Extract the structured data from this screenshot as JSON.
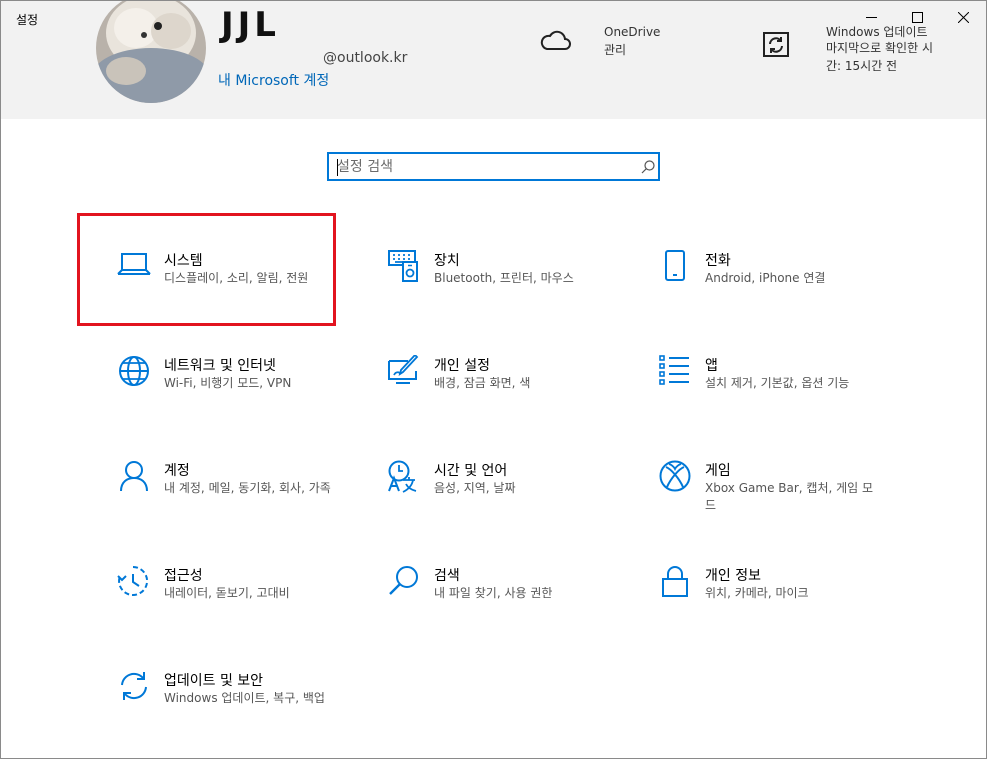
{
  "window": {
    "title": "설정"
  },
  "account": {
    "name": "JJL",
    "email": "@outlook.kr",
    "link": "내 Microsoft 계정"
  },
  "onedrive": {
    "title": "OneDrive",
    "subtitle": "관리"
  },
  "update": {
    "title": "Windows 업데이트",
    "line1": "마지막으로 확인한 시",
    "line2": "간: 15시간 전"
  },
  "search": {
    "placeholder": "설정 검색",
    "value": ""
  },
  "tiles": [
    {
      "name": "시스템",
      "desc": "디스플레이, 소리, 알림, 전원",
      "icon": "laptop-icon"
    },
    {
      "name": "장치",
      "desc": "Bluetooth, 프린터, 마우스",
      "icon": "devices-icon"
    },
    {
      "name": "전화",
      "desc": "Android, iPhone 연결",
      "icon": "phone-icon"
    },
    {
      "name": "네트워크 및 인터넷",
      "desc": "Wi-Fi, 비행기 모드, VPN",
      "icon": "globe-icon"
    },
    {
      "name": "개인 설정",
      "desc": "배경, 잠금 화면, 색",
      "icon": "personalization-icon"
    },
    {
      "name": "앱",
      "desc": "설치 제거, 기본값, 옵션 기능",
      "icon": "apps-icon"
    },
    {
      "name": "계정",
      "desc": "내 계정, 메일, 동기화, 회사, 가족",
      "icon": "person-icon"
    },
    {
      "name": "시간 및 언어",
      "desc": "음성, 지역, 날짜",
      "icon": "time-language-icon"
    },
    {
      "name": "게임",
      "desc": "Xbox Game Bar, 캡처, 게임 모드",
      "icon": "xbox-icon"
    },
    {
      "name": "접근성",
      "desc": "내레이터, 돋보기, 고대비",
      "icon": "accessibility-icon"
    },
    {
      "name": "검색",
      "desc": "내 파일 찾기, 사용 권한",
      "icon": "search-magnifier-icon"
    },
    {
      "name": "개인 정보",
      "desc": "위치, 카메라, 마이크",
      "icon": "lock-icon"
    },
    {
      "name": "업데이트 및 보안",
      "desc": "Windows 업데이트, 복구, 백업",
      "icon": "update-sync-icon"
    }
  ],
  "colors": {
    "accent": "#0078d7",
    "highlight": "#e2141f",
    "header_bg": "#f2f2f2"
  }
}
